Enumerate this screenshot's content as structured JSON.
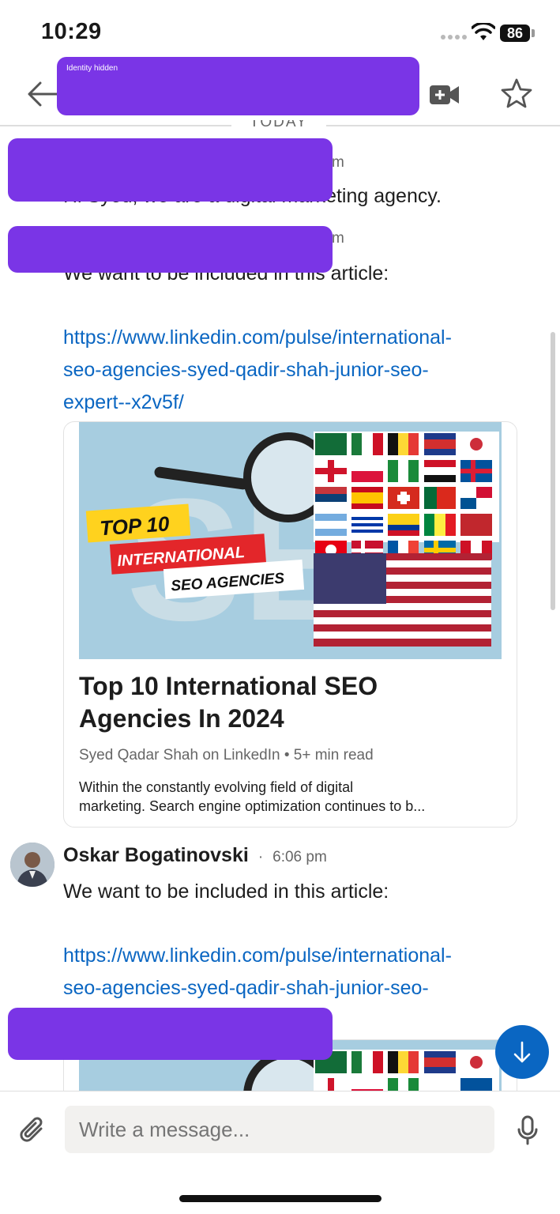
{
  "status_bar": {
    "time": "10:29",
    "battery": "86"
  },
  "header": {
    "redaction_label": "Identity hidden",
    "back_icon": "arrow-left-icon",
    "video_icon": "video-camera-icon",
    "star_icon": "star-outline-icon"
  },
  "date_divider": "TODAY",
  "messages": [
    {
      "meta_tail": "m",
      "text": "Hi Syed, we are a digital marketing agency."
    },
    {
      "meta_tail": "m",
      "text": "We want to be included in this article:",
      "link": [
        "https://www.linkedin.com/pulse/international-",
        "seo-agencies-syed-qadir-shah-junior-seo-",
        "expert--x2v5f/"
      ],
      "card": {
        "title_lines": [
          "Top 10 International SEO",
          "Agencies In 2024"
        ],
        "meta": "Syed Qadar Shah on LinkedIn • 5+ min read",
        "desc_lines": [
          "Within the constantly evolving field of digital",
          "marketing. Search engine optimization continues to b..."
        ],
        "image_text": {
          "top": "TOP 10",
          "mid": "INTERNATIONAL",
          "bottom": "SEO AGENCIES"
        }
      }
    },
    {
      "sender": "Oskar Bogatinovski",
      "sep": "·",
      "timestamp": "6:06 pm",
      "text": "We want to be included in this article:",
      "link": [
        "https://www.linkedin.com/pulse/international-",
        "seo-agencies-syed-qadir-shah-junior-seo-"
      ]
    }
  ],
  "composer": {
    "placeholder": "Write a message...",
    "attach_icon": "paperclip-icon",
    "mic_icon": "microphone-icon"
  },
  "fab_icon": "arrow-down-icon",
  "colors": {
    "accent": "#0a66c2",
    "redaction": "#7a35e6"
  }
}
